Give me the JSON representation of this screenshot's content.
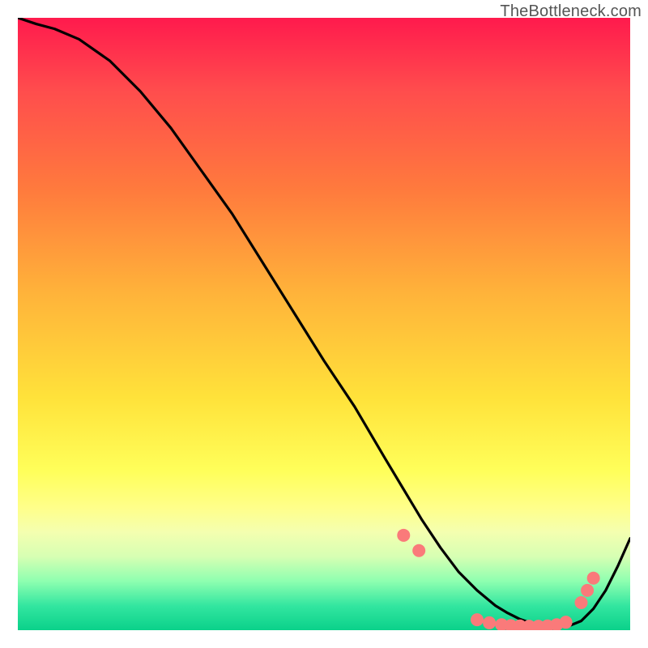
{
  "watermark": "TheBottleneck.com",
  "chart_data": {
    "type": "line",
    "title": "",
    "xlabel": "",
    "ylabel": "",
    "xlim": [
      0,
      100
    ],
    "ylim": [
      0,
      100
    ],
    "series": [
      {
        "name": "curve",
        "x": [
          0,
          3,
          6,
          10,
          15,
          20,
          25,
          30,
          35,
          40,
          45,
          50,
          55,
          60,
          63,
          66,
          69,
          72,
          75,
          78,
          80,
          82,
          84,
          86,
          88,
          90,
          92,
          94,
          96,
          98,
          100
        ],
        "y": [
          100,
          99,
          98.2,
          96.5,
          93,
          88,
          82,
          75,
          68,
          60,
          52,
          44,
          36.5,
          28,
          23,
          18,
          13.5,
          9.5,
          6.5,
          4,
          2.8,
          1.8,
          1.1,
          0.7,
          0.6,
          0.7,
          1.5,
          3.5,
          6.5,
          10.5,
          15
        ]
      }
    ],
    "markers": {
      "name": "dots",
      "color": "#fa7a7a",
      "points": [
        {
          "x": 63.0,
          "y": 15.5
        },
        {
          "x": 65.5,
          "y": 13.0
        },
        {
          "x": 75.0,
          "y": 1.7
        },
        {
          "x": 77.0,
          "y": 1.2
        },
        {
          "x": 79.0,
          "y": 0.9
        },
        {
          "x": 80.5,
          "y": 0.75
        },
        {
          "x": 82.0,
          "y": 0.7
        },
        {
          "x": 83.5,
          "y": 0.65
        },
        {
          "x": 85.0,
          "y": 0.65
        },
        {
          "x": 86.5,
          "y": 0.7
        },
        {
          "x": 88.0,
          "y": 0.9
        },
        {
          "x": 89.5,
          "y": 1.3
        },
        {
          "x": 92.0,
          "y": 4.5
        },
        {
          "x": 93.0,
          "y": 6.5
        },
        {
          "x": 94.0,
          "y": 8.5
        }
      ]
    }
  }
}
